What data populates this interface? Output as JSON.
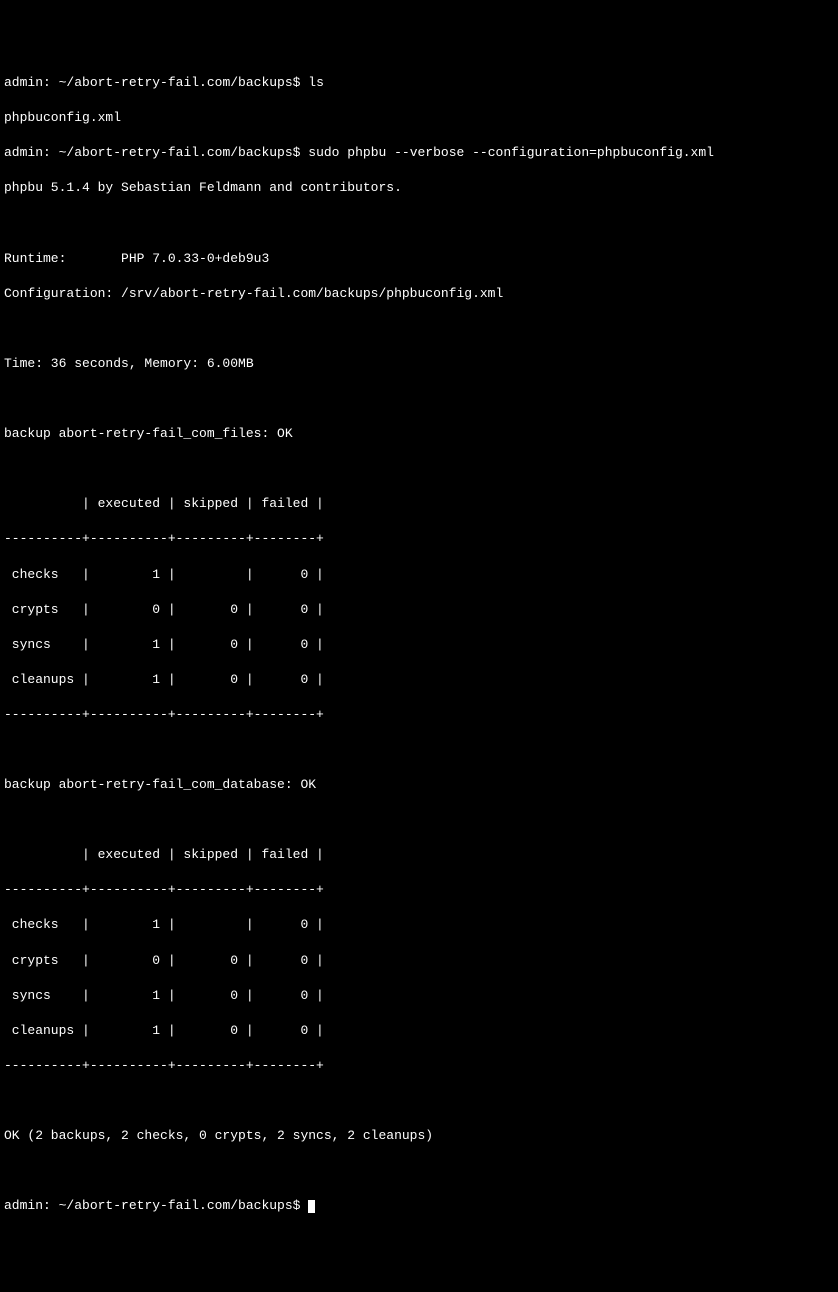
{
  "prompt1_user": "admin",
  "prompt1_path": "~/abort-retry-fail.com/backups",
  "prompt1_cmd": "ls",
  "ls_out": "phpbuconfig.xml",
  "prompt2_user": "admin",
  "prompt2_path": "~/abort-retry-fail.com/backups",
  "prompt2_cmd": "sudo phpbu --verbose --configuration=phpbuconfig.xml",
  "banner": "phpbu 5.1.4 by Sebastian Feldmann and contributors.",
  "runtime_line": "Runtime:       PHP 7.0.33-0+deb9u3",
  "configuration_line": "Configuration: /srv/abort-retry-fail.com/backups/phpbuconfig.xml",
  "time_mem": "Time: 36 seconds, Memory: 6.00MB",
  "backup1_title": "backup abort-retry-fail_com_files: OK",
  "backup2_title": "backup abort-retry-fail_com_database: OK",
  "hdr": "          | executed | skipped | failed |",
  "sep": "----------+----------+---------+--------+",
  "t1r1": " checks   |        1 |         |      0 |",
  "t1r2": " crypts   |        0 |       0 |      0 |",
  "t1r3": " syncs    |        1 |       0 |      0 |",
  "t1r4": " cleanups |        1 |       0 |      0 |",
  "t2r1": " checks   |        1 |         |      0 |",
  "t2r2": " crypts   |        0 |       0 |      0 |",
  "t2r3": " syncs    |        1 |       0 |      0 |",
  "t2r4": " cleanups |        1 |       0 |      0 |",
  "summary": "OK (2 backups, 2 checks, 0 crypts, 2 syncs, 2 cleanups)",
  "prompt3_user": "admin",
  "prompt3_path": "~/abort-retry-fail.com/backups",
  "prompt3_cmd": "",
  "chart_data": {
    "type": "table",
    "tables": [
      {
        "title": "abort-retry-fail_com_files",
        "columns": [
          "executed",
          "skipped",
          "failed"
        ],
        "rows": {
          "checks": [
            1,
            null,
            0
          ],
          "crypts": [
            0,
            0,
            0
          ],
          "syncs": [
            1,
            0,
            0
          ],
          "cleanups": [
            1,
            0,
            0
          ]
        }
      },
      {
        "title": "abort-retry-fail_com_database",
        "columns": [
          "executed",
          "skipped",
          "failed"
        ],
        "rows": {
          "checks": [
            1,
            null,
            0
          ],
          "crypts": [
            0,
            0,
            0
          ],
          "syncs": [
            1,
            0,
            0
          ],
          "cleanups": [
            1,
            0,
            0
          ]
        }
      }
    ],
    "summary": {
      "backups": 2,
      "checks": 2,
      "crypts": 0,
      "syncs": 2,
      "cleanups": 2
    }
  }
}
